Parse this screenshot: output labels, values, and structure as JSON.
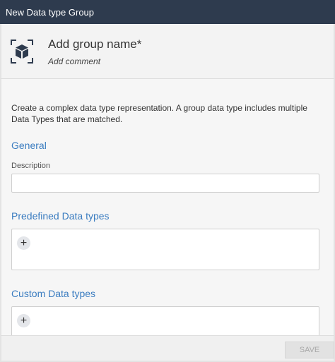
{
  "window": {
    "title": "New Data type Group"
  },
  "header": {
    "icon": "cube-in-frame-icon",
    "name_placeholder": "Add group name*",
    "comment_placeholder": "Add comment"
  },
  "intro_text": "Create a complex data type representation. A group data type includes multiple Data Types that are matched.",
  "general": {
    "title": "General",
    "description_label": "Description",
    "description_value": ""
  },
  "predefined": {
    "title": "Predefined Data types",
    "add_icon": "+"
  },
  "custom": {
    "title": "Custom Data types",
    "add_icon": "+"
  },
  "footer": {
    "save_label": "SAVE"
  },
  "colors": {
    "titlebar": "#2e3b4e",
    "section_title": "#3a7cc0",
    "disabled_button": "#e2e2e2"
  }
}
